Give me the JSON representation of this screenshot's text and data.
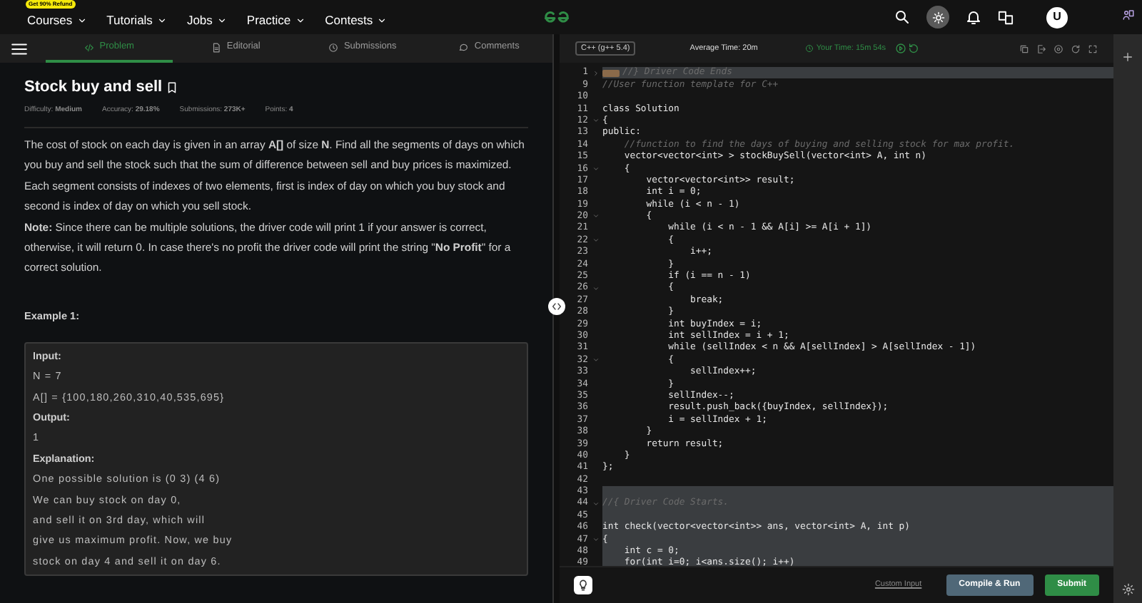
{
  "topnav": {
    "badge": "Get 90% Refund",
    "items": [
      {
        "label": "Courses"
      },
      {
        "label": "Tutorials"
      },
      {
        "label": "Jobs"
      },
      {
        "label": "Practice"
      },
      {
        "label": "Contests"
      }
    ],
    "avatar": "U"
  },
  "tabs": [
    {
      "label": "Problem",
      "selected": true
    },
    {
      "label": "Editorial",
      "selected": false
    },
    {
      "label": "Submissions",
      "selected": false
    },
    {
      "label": "Comments",
      "selected": false
    }
  ],
  "problem": {
    "title": "Stock buy and sell",
    "meta": [
      "Difficulty: **Medium**",
      "Accuracy: **29.18%**",
      "Submissions: **273K+**",
      "Points: **4**"
    ],
    "paragraphs": [
      "The cost of stock on each day is given in an array **A[]** of size **N**. Find all the segments of days on which you buy and sell the stock such that the sum of difference between sell and buy prices is maximized. Each segment consists of indexes of two elements, first is index of day on which you buy stock and second is index of day on which you sell stock.\n**Note:** Since there can be multiple solutions, the driver code will print 1 if your answer is correct, otherwise, it will return 0. In case there's no profit the driver code will print the string \"**No Profit**\" for a correct solution."
    ],
    "example_title": "Example 1:",
    "example_lines": [
      {
        "kind": "heading",
        "text": "Input:"
      },
      {
        "kind": "text",
        "text": "N = 7"
      },
      {
        "kind": "text",
        "text": "A[] = {100,180,260,310,40,535,695}"
      },
      {
        "kind": "heading",
        "text": "Output:"
      },
      {
        "kind": "text",
        "text": "1"
      },
      {
        "kind": "heading",
        "text": "Explanation:"
      },
      {
        "kind": "text",
        "text": "One possible solution is (0 3) (4 6)"
      },
      {
        "kind": "text",
        "text": "We can buy stock on day 0,"
      },
      {
        "kind": "text",
        "text": "and sell it on 3rd day, which will"
      },
      {
        "kind": "text",
        "text": "give us maximum profit. Now, we buy"
      },
      {
        "kind": "text",
        "text": "stock on day 4 and sell it on day 6."
      }
    ]
  },
  "editor": {
    "language": "C++ (g++ 5.4)",
    "average_time": "Average Time: 20m",
    "your_time": "Your Time: 15m 54s",
    "lines": [
      {
        "num": "1",
        "text": "//} Driver Code Ends",
        "kind": "comment",
        "foldable": true,
        "folded": true,
        "shaded": true
      },
      {
        "num": "9",
        "text": "//User function template for C++",
        "kind": "comment",
        "foldable": false,
        "folded": false,
        "shaded": false
      },
      {
        "num": "10",
        "foldable": false,
        "folded": false,
        "shaded": false
      },
      {
        "num": "11",
        "text": "class Solution",
        "kind": "code",
        "foldable": false,
        "folded": false,
        "shaded": false
      },
      {
        "num": "12",
        "text": "{",
        "kind": "code",
        "foldable": true,
        "folded": false,
        "shaded": false
      },
      {
        "num": "13",
        "text": "public:",
        "kind": "code",
        "foldable": false,
        "folded": false,
        "shaded": false
      },
      {
        "num": "14",
        "text": "    //function to find the days of buying and selling stock for max profit.",
        "kind": "comment",
        "foldable": false,
        "folded": false,
        "shaded": false
      },
      {
        "num": "15",
        "text": "    vector<vector<int> > stockBuySell(vector<int> A, int n)",
        "kind": "code",
        "foldable": false,
        "folded": false,
        "shaded": false
      },
      {
        "num": "16",
        "text": "    {",
        "kind": "code",
        "foldable": true,
        "folded": false,
        "shaded": false
      },
      {
        "num": "17",
        "text": "        vector<vector<int>> result;",
        "kind": "code",
        "foldable": false,
        "folded": false,
        "shaded": false
      },
      {
        "num": "18",
        "text": "        int i = 0;",
        "kind": "code",
        "foldable": false,
        "folded": false,
        "shaded": false
      },
      {
        "num": "19",
        "text": "        while (i < n - 1)",
        "kind": "code",
        "foldable": false,
        "folded": false,
        "shaded": false
      },
      {
        "num": "20",
        "text": "        {",
        "kind": "code",
        "foldable": true,
        "folded": false,
        "shaded": false
      },
      {
        "num": "21",
        "text": "            while (i < n - 1 && A[i] >= A[i + 1])",
        "kind": "code",
        "foldable": false,
        "folded": false,
        "shaded": false
      },
      {
        "num": "22",
        "text": "            {",
        "kind": "code",
        "foldable": true,
        "folded": false,
        "shaded": false
      },
      {
        "num": "23",
        "text": "                i++;",
        "kind": "code",
        "foldable": false,
        "folded": false,
        "shaded": false
      },
      {
        "num": "24",
        "text": "            }",
        "kind": "code",
        "foldable": false,
        "folded": false,
        "shaded": false
      },
      {
        "num": "25",
        "text": "            if (i == n - 1)",
        "kind": "code",
        "foldable": false,
        "folded": false,
        "shaded": false
      },
      {
        "num": "26",
        "text": "            {",
        "kind": "code",
        "foldable": true,
        "folded": false,
        "shaded": false
      },
      {
        "num": "27",
        "text": "                break;",
        "kind": "code",
        "foldable": false,
        "folded": false,
        "shaded": false
      },
      {
        "num": "28",
        "text": "            }",
        "kind": "code",
        "foldable": false,
        "folded": false,
        "shaded": false
      },
      {
        "num": "29",
        "text": "            int buyIndex = i;",
        "kind": "code",
        "foldable": false,
        "folded": false,
        "shaded": false
      },
      {
        "num": "30",
        "text": "            int sellIndex = i + 1;",
        "kind": "code",
        "foldable": false,
        "folded": false,
        "shaded": false
      },
      {
        "num": "31",
        "text": "            while (sellIndex < n && A[sellIndex] > A[sellIndex - 1])",
        "kind": "code",
        "foldable": false,
        "folded": false,
        "shaded": false
      },
      {
        "num": "32",
        "text": "            {",
        "kind": "code",
        "foldable": true,
        "folded": false,
        "shaded": false
      },
      {
        "num": "33",
        "text": "                sellIndex++;",
        "kind": "code",
        "foldable": false,
        "folded": false,
        "shaded": false
      },
      {
        "num": "34",
        "text": "            }",
        "kind": "code",
        "foldable": false,
        "folded": false,
        "shaded": false
      },
      {
        "num": "35",
        "text": "            sellIndex--;",
        "kind": "code",
        "foldable": false,
        "folded": false,
        "shaded": false
      },
      {
        "num": "36",
        "text": "            result.push_back({buyIndex, sellIndex});",
        "kind": "code",
        "foldable": false,
        "folded": false,
        "shaded": false
      },
      {
        "num": "37",
        "text": "            i = sellIndex + 1;",
        "kind": "code",
        "foldable": false,
        "folded": false,
        "shaded": false
      },
      {
        "num": "38",
        "text": "        }",
        "kind": "code",
        "foldable": false,
        "folded": false,
        "shaded": false
      },
      {
        "num": "39",
        "text": "        return result;",
        "kind": "code",
        "foldable": false,
        "folded": false,
        "shaded": false
      },
      {
        "num": "40",
        "text": "    }",
        "kind": "code",
        "foldable": false,
        "folded": false,
        "shaded": false
      },
      {
        "num": "41",
        "text": "};",
        "kind": "code",
        "foldable": false,
        "folded": false,
        "shaded": false
      },
      {
        "num": "42",
        "foldable": false,
        "folded": false,
        "shaded": false
      },
      {
        "num": "43",
        "foldable": false,
        "folded": false,
        "shaded": true
      },
      {
        "num": "44",
        "text": "//{ Driver Code Starts.",
        "kind": "comment",
        "foldable": true,
        "folded": false,
        "shaded": true
      },
      {
        "num": "45",
        "foldable": false,
        "folded": false,
        "shaded": true
      },
      {
        "num": "46",
        "text": "int check(vector<vector<int>> ans, vector<int> A, int p)",
        "kind": "code",
        "foldable": false,
        "folded": false,
        "shaded": true
      },
      {
        "num": "47",
        "text": "{",
        "kind": "code",
        "foldable": true,
        "folded": false,
        "shaded": true
      },
      {
        "num": "48",
        "text": "    int c = 0;",
        "kind": "code",
        "foldable": false,
        "folded": false,
        "shaded": true
      },
      {
        "num": "49",
        "text": "    for(int i=0; i<ans.size(); i++)",
        "kind": "code",
        "foldable": false,
        "folded": false,
        "shaded": true
      }
    ],
    "custom_input": "Custom Input",
    "compile_button": "Compile & Run",
    "submit_button": "Submit"
  }
}
